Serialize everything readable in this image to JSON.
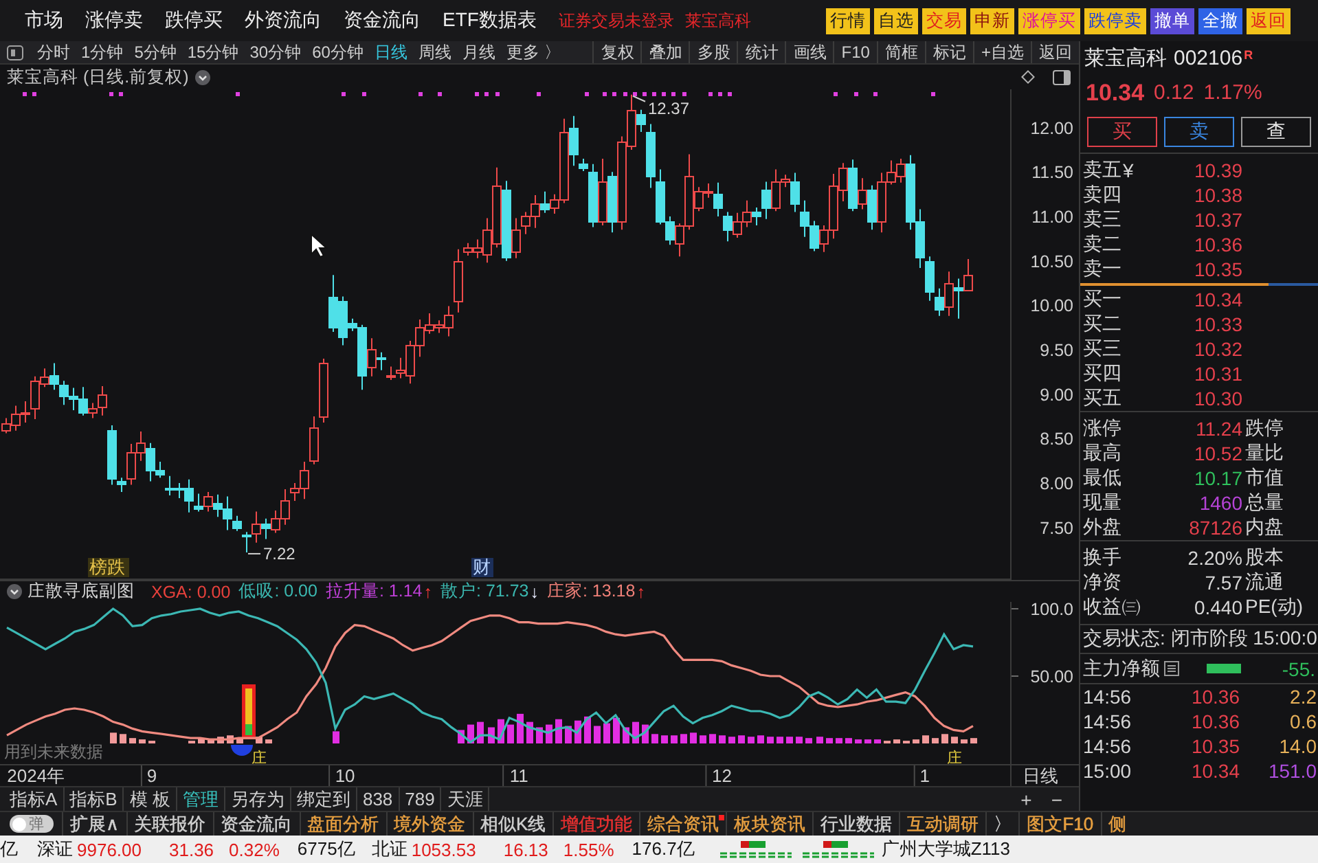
{
  "menu_bar": {
    "items": [
      "市场",
      "涨停卖",
      "跌停买",
      "外资流向",
      "资金流向",
      "ETF数据表"
    ],
    "notices": [
      "证券交易未登录",
      "莱宝高科"
    ],
    "actions": [
      {
        "label": "行情",
        "color": "#f2c21a",
        "kind": "dark"
      },
      {
        "label": "自选",
        "color": "#f2c21a",
        "kind": "dark"
      },
      {
        "label": "交易",
        "color": "#f2c21a",
        "kind": "red"
      },
      {
        "label": "申新",
        "color": "#f2c21a",
        "kind": "maroon"
      },
      {
        "label": "涨停买",
        "color": "#f2c21a",
        "kind": "magenta"
      },
      {
        "label": "跌停卖",
        "color": "#f2c21a",
        "kind": "blue"
      },
      {
        "label": "撤单",
        "color": "#5b4bd6",
        "kind": "white"
      },
      {
        "label": "全撤",
        "color": "#2f63e6",
        "kind": "white"
      },
      {
        "label": "返回",
        "color": "#f2c21a",
        "kind": "red"
      }
    ]
  },
  "toolbar": {
    "periods": [
      {
        "label": "分时",
        "selected": false
      },
      {
        "label": "1分钟",
        "selected": false
      },
      {
        "label": "5分钟",
        "selected": false
      },
      {
        "label": "15分钟",
        "selected": false
      },
      {
        "label": "30分钟",
        "selected": false
      },
      {
        "label": "60分钟",
        "selected": false
      },
      {
        "label": "日线",
        "selected": true
      },
      {
        "label": "周线",
        "selected": false
      },
      {
        "label": "月线",
        "selected": false
      },
      {
        "label": "更多 〉",
        "selected": false
      }
    ],
    "tools": [
      "复权",
      "叠加",
      "多股",
      "统计",
      "画线",
      "F10",
      "简框",
      "标记",
      "+自选",
      "返回"
    ]
  },
  "price_chart": {
    "title": "莱宝高科 (日线.前复权)",
    "markers": [
      {
        "label": "榜跌",
        "kind": "ranking"
      },
      {
        "label": "财",
        "kind": "finance"
      }
    ],
    "chart_data": {
      "type": "candlestick",
      "categories": [
        null,
        null,
        null,
        null,
        null,
        null,
        null,
        null,
        null,
        null,
        null,
        null,
        null,
        null,
        null,
        null,
        null,
        null,
        null,
        null,
        null,
        null,
        null,
        null,
        null,
        null,
        null,
        null,
        null,
        null,
        null,
        null,
        null,
        null,
        null,
        null,
        null,
        null,
        null,
        null,
        null,
        null,
        null,
        null,
        null,
        null,
        null,
        null,
        null,
        null,
        null,
        null,
        null,
        null,
        null,
        null,
        null,
        null,
        null,
        null,
        null,
        null,
        null,
        null,
        null,
        null,
        null,
        null,
        null,
        null,
        null,
        null,
        null,
        null,
        null,
        null,
        null,
        null,
        null,
        null,
        null,
        null,
        null,
        null,
        null,
        null,
        null,
        null,
        null,
        null,
        null,
        null,
        null,
        null,
        null,
        null,
        null,
        null,
        null,
        null,
        null,
        null,
        null,
        null,
        null
      ],
      "ohlc": [
        [
          8.6,
          8.73,
          8.56,
          8.68
        ],
        [
          8.66,
          8.87,
          8.59,
          8.78
        ],
        [
          8.78,
          8.92,
          8.68,
          8.79
        ],
        [
          8.85,
          9.2,
          8.72,
          9.15
        ],
        [
          9.12,
          9.29,
          9.08,
          9.2
        ],
        [
          9.22,
          9.35,
          9.05,
          9.12
        ],
        [
          9.1,
          9.15,
          8.88,
          8.98
        ],
        [
          8.98,
          9.07,
          8.82,
          8.95
        ],
        [
          8.95,
          9.08,
          8.76,
          8.8
        ],
        [
          8.8,
          8.9,
          8.73,
          8.85
        ],
        [
          8.86,
          9.09,
          8.76,
          9.0
        ],
        [
          8.6,
          8.65,
          7.98,
          8.05
        ],
        [
          8.02,
          8.06,
          7.9,
          8.0
        ],
        [
          8.05,
          8.44,
          7.98,
          8.35
        ],
        [
          8.35,
          8.58,
          8.25,
          8.45
        ],
        [
          8.4,
          8.45,
          8.02,
          8.15
        ],
        [
          8.15,
          8.24,
          8.06,
          8.1
        ],
        [
          7.95,
          8.08,
          7.86,
          7.93
        ],
        [
          7.95,
          8.0,
          7.83,
          7.93
        ],
        [
          7.95,
          8.04,
          7.67,
          7.8
        ],
        [
          7.75,
          7.88,
          7.68,
          7.72
        ],
        [
          7.75,
          7.9,
          7.68,
          7.85
        ],
        [
          7.78,
          7.87,
          7.62,
          7.72
        ],
        [
          7.72,
          7.85,
          7.47,
          7.6
        ],
        [
          7.58,
          7.63,
          7.46,
          7.5
        ],
        [
          7.42,
          7.45,
          7.22,
          7.4
        ],
        [
          7.43,
          7.68,
          7.33,
          7.55
        ],
        [
          7.55,
          7.6,
          7.37,
          7.5
        ],
        [
          7.48,
          7.69,
          7.44,
          7.6
        ],
        [
          7.6,
          7.93,
          7.53,
          7.8
        ],
        [
          7.9,
          8.0,
          7.8,
          7.95
        ],
        [
          7.95,
          8.24,
          7.82,
          8.15
        ],
        [
          8.25,
          8.75,
          8.21,
          8.62
        ],
        [
          8.75,
          9.4,
          8.68,
          9.35
        ],
        [
          10.1,
          10.34,
          9.7,
          9.75
        ],
        [
          10.05,
          10.1,
          9.55,
          9.65
        ],
        [
          9.8,
          9.85,
          9.71,
          9.75
        ],
        [
          9.75,
          9.78,
          9.05,
          9.22
        ],
        [
          9.3,
          9.63,
          9.2,
          9.5
        ],
        [
          9.42,
          9.47,
          9.27,
          9.4
        ],
        [
          9.2,
          9.31,
          9.16,
          9.22
        ],
        [
          9.25,
          9.41,
          9.18,
          9.28
        ],
        [
          9.22,
          9.6,
          9.12,
          9.55
        ],
        [
          9.55,
          9.84,
          9.42,
          9.75
        ],
        [
          9.72,
          9.91,
          9.68,
          9.78
        ],
        [
          9.76,
          9.83,
          9.69,
          9.78
        ],
        [
          9.75,
          9.99,
          9.65,
          9.9
        ],
        [
          10.05,
          10.63,
          9.92,
          10.5
        ],
        [
          10.6,
          10.7,
          10.56,
          10.65
        ],
        [
          10.6,
          10.74,
          10.53,
          10.65
        ],
        [
          10.58,
          10.98,
          10.48,
          10.85
        ],
        [
          10.7,
          11.55,
          10.65,
          11.35
        ],
        [
          11.3,
          11.4,
          10.5,
          10.55
        ],
        [
          10.6,
          10.98,
          10.53,
          10.85
        ],
        [
          10.9,
          11.05,
          10.8,
          11.0
        ],
        [
          11.0,
          11.24,
          10.87,
          11.15
        ],
        [
          11.15,
          11.28,
          11.04,
          11.08
        ],
        [
          11.1,
          11.25,
          11.03,
          11.2
        ],
        [
          11.2,
          12.1,
          11.15,
          11.95
        ],
        [
          12.0,
          12.13,
          11.57,
          11.7
        ],
        [
          11.6,
          11.65,
          11.51,
          11.55
        ],
        [
          11.5,
          11.59,
          10.88,
          10.95
        ],
        [
          10.95,
          11.65,
          10.9,
          11.4
        ],
        [
          11.45,
          11.5,
          10.82,
          10.95
        ],
        [
          10.95,
          11.9,
          10.85,
          11.85
        ],
        [
          11.8,
          12.37,
          11.75,
          12.2
        ],
        [
          12.15,
          12.2,
          11.95,
          12.05
        ],
        [
          11.95,
          12.04,
          11.32,
          11.45
        ],
        [
          11.4,
          11.53,
          10.91,
          10.95
        ],
        [
          10.95,
          11.0,
          10.68,
          10.75
        ],
        [
          10.7,
          10.92,
          10.55,
          10.9
        ],
        [
          10.9,
          11.7,
          10.85,
          11.45
        ],
        [
          11.1,
          11.33,
          11.06,
          11.28
        ],
        [
          11.28,
          11.37,
          11.21,
          11.28
        ],
        [
          11.25,
          11.38,
          11.0,
          11.1
        ],
        [
          11.0,
          11.05,
          10.72,
          10.85
        ],
        [
          10.8,
          11.04,
          10.76,
          10.95
        ],
        [
          10.95,
          11.18,
          10.88,
          11.05
        ],
        [
          11.05,
          11.1,
          10.9,
          11.0
        ],
        [
          11.3,
          11.39,
          10.97,
          11.1
        ],
        [
          11.1,
          11.53,
          11.06,
          11.4
        ],
        [
          11.4,
          11.47,
          11.33,
          11.42
        ],
        [
          11.4,
          11.49,
          11.05,
          11.15
        ],
        [
          11.05,
          11.18,
          10.77,
          10.9
        ],
        [
          10.9,
          10.95,
          10.61,
          10.65
        ],
        [
          10.7,
          10.9,
          10.6,
          10.85
        ],
        [
          10.85,
          11.48,
          10.75,
          11.35
        ],
        [
          11.3,
          11.6,
          11.17,
          11.55
        ],
        [
          11.55,
          11.64,
          11.06,
          11.1
        ],
        [
          11.15,
          11.43,
          11.08,
          11.3
        ],
        [
          11.3,
          11.35,
          10.85,
          10.95
        ],
        [
          10.95,
          11.49,
          10.82,
          11.4
        ],
        [
          11.4,
          11.63,
          11.36,
          11.5
        ],
        [
          11.45,
          11.65,
          11.38,
          11.6
        ],
        [
          11.6,
          11.69,
          10.85,
          10.95
        ],
        [
          10.95,
          11.08,
          10.42,
          10.55
        ],
        [
          10.5,
          10.55,
          10.05,
          10.15
        ],
        [
          10.1,
          10.19,
          9.88,
          9.95
        ],
        [
          9.98,
          10.38,
          9.88,
          10.25
        ],
        [
          10.2,
          10.3,
          9.85,
          10.17
        ],
        [
          10.18,
          10.52,
          10.17,
          10.34
        ],
        null,
        null,
        null,
        null
      ],
      "ylim": [
        6.91,
        12.43
      ],
      "yticks": [
        {
          "value": 12,
          "label": "12.00"
        },
        {
          "value": 11.5,
          "label": "11.50"
        },
        {
          "value": 11,
          "label": "11.00"
        },
        {
          "value": 10.5,
          "label": "10.50"
        },
        {
          "value": 10,
          "label": "10.00"
        },
        {
          "value": 9.5,
          "label": "9.50"
        },
        {
          "value": 9,
          "label": "9.00"
        },
        {
          "value": 8.5,
          "label": "8.50"
        },
        {
          "value": 8,
          "label": "8.00"
        },
        {
          "value": 7.5,
          "label": "7.50"
        }
      ],
      "annotations": [
        "12.37",
        "7.22"
      ]
    }
  },
  "indicator": {
    "name": "庄散寻底副图",
    "readings": [
      {
        "text": "XGA: 0.00",
        "color": "#e8413c"
      },
      {
        "text": "低吸: 0.00",
        "color": "#3bb8b0"
      },
      {
        "text": "拉升量: 1.14",
        "color": "#c040d8",
        "arrow": {
          "text": "↑",
          "color": "#ff3a3a"
        }
      },
      {
        "text": "散户: 71.73",
        "color": "#3bb8b0",
        "arrow": {
          "text": "↓",
          "color": "#e8ecff"
        }
      },
      {
        "text": "庄家: 13.18",
        "color": "#f08078",
        "arrow": {
          "text": "↑",
          "color": "#ff3a3a"
        }
      }
    ],
    "note": "用到未来数据",
    "signals": [
      "庄",
      "庄"
    ],
    "period": "日线",
    "chart_data": {
      "type": "line",
      "categories": [
        null,
        null,
        null,
        "2024年",
        null,
        null,
        null,
        null,
        null,
        null,
        null,
        null,
        null,
        null,
        null,
        "9",
        null,
        null,
        null,
        null,
        null,
        null,
        null,
        null,
        null,
        null,
        null,
        null,
        null,
        null,
        null,
        null,
        null,
        null,
        null,
        "10",
        null,
        null,
        null,
        null,
        null,
        null,
        null,
        null,
        null,
        null,
        null,
        null,
        null,
        null,
        null,
        null,
        null,
        "11",
        null,
        null,
        null,
        null,
        null,
        null,
        null,
        null,
        null,
        null,
        null,
        null,
        null,
        null,
        null,
        null,
        null,
        null,
        null,
        null,
        "12",
        null,
        null,
        null,
        null,
        null,
        null,
        null,
        null,
        null,
        null,
        null,
        null,
        null,
        null,
        null,
        null,
        null,
        null,
        null,
        null,
        "1",
        null,
        null,
        null,
        null,
        null
      ],
      "series": [
        {
          "type": "bar",
          "color": "#f29a9a",
          "values": [
            null,
            null,
            null,
            null,
            null,
            null,
            null,
            null,
            null,
            null,
            null,
            8,
            7,
            4,
            3,
            2,
            null,
            null,
            null,
            2,
            4,
            3,
            5,
            6,
            4,
            null,
            5,
            3,
            null,
            null,
            null,
            null,
            null,
            null,
            null,
            null,
            null,
            null,
            null,
            null,
            null,
            null,
            null,
            null,
            null,
            null,
            null,
            null,
            null,
            null,
            null,
            null,
            null,
            null,
            null,
            null,
            null,
            null,
            null,
            null,
            null,
            null,
            null,
            null,
            null,
            null,
            null,
            null,
            null,
            null,
            null,
            null,
            null,
            null,
            null,
            null,
            null,
            null,
            null,
            null,
            null,
            null,
            null,
            null,
            null,
            null,
            null,
            null,
            null,
            null,
            null,
            2,
            3,
            2,
            3,
            6,
            4,
            7,
            5,
            3,
            4
          ]
        },
        {
          "type": "bar",
          "color": "#e22ee2",
          "values": [
            null,
            null,
            null,
            null,
            null,
            null,
            null,
            null,
            null,
            null,
            null,
            null,
            null,
            null,
            null,
            null,
            null,
            null,
            null,
            null,
            null,
            null,
            null,
            null,
            null,
            null,
            null,
            null,
            null,
            null,
            null,
            null,
            null,
            null,
            9,
            null,
            null,
            null,
            null,
            null,
            null,
            null,
            null,
            null,
            null,
            null,
            null,
            10,
            14,
            16,
            12,
            18,
            14,
            22,
            16,
            12,
            14,
            18,
            13,
            17,
            20,
            13,
            15,
            19,
            12,
            16,
            14,
            7,
            6,
            6,
            7,
            8,
            6,
            7,
            6,
            5,
            6,
            5,
            6,
            5,
            5,
            5,
            5,
            4,
            5,
            4,
            4,
            4,
            3,
            3,
            3,
            null,
            null,
            null,
            null,
            null,
            null,
            null,
            null,
            null,
            null
          ]
        },
        {
          "color": "#f08a80",
          "values": [
            6,
            10,
            14,
            17,
            20,
            22,
            25,
            26,
            25,
            23,
            20,
            16,
            14,
            11,
            9,
            8,
            7,
            6,
            5,
            4,
            4,
            3,
            3,
            3,
            4,
            4,
            4,
            8,
            12,
            18,
            23,
            35,
            44,
            56,
            72,
            82,
            88,
            87,
            84,
            81,
            78,
            73,
            69,
            71,
            73,
            76,
            81,
            86,
            91,
            93,
            95,
            95,
            93,
            90,
            90,
            89,
            89,
            89,
            90,
            89,
            88,
            86,
            83,
            81,
            80,
            81,
            82,
            83,
            80,
            70,
            62,
            62,
            62,
            62,
            61,
            58,
            56,
            54,
            51,
            50,
            50,
            46,
            42,
            36,
            30,
            28,
            27,
            28,
            29,
            31,
            32,
            34,
            36,
            38,
            35,
            28,
            19,
            13,
            10,
            9,
            13
          ]
        },
        {
          "color": "#3cb8b4",
          "values": [
            86,
            82,
            78,
            74,
            70,
            74,
            78,
            83,
            85,
            88,
            94,
            100,
            95,
            87,
            88,
            93,
            95,
            96,
            98,
            99,
            100,
            97,
            95,
            97,
            98,
            95,
            93,
            90,
            87,
            82,
            77,
            70,
            60,
            45,
            11,
            25,
            29,
            35,
            33,
            35,
            37,
            33,
            29,
            23,
            20,
            18,
            12,
            7,
            1,
            6,
            6,
            3,
            19,
            16,
            12,
            10,
            8,
            11,
            12,
            8,
            18,
            23,
            15,
            21,
            10,
            4,
            8,
            16,
            24,
            28,
            20,
            15,
            19,
            21,
            24,
            28,
            26,
            24,
            24,
            22,
            19,
            21,
            27,
            35,
            38,
            34,
            29,
            33,
            40,
            34,
            40,
            31,
            31,
            30,
            40,
            54,
            67,
            81,
            70,
            73,
            72
          ]
        }
      ],
      "ylim": [
        -15.3,
        105.1
      ],
      "yticks": [
        {
          "value": 100,
          "label": "100.0"
        },
        {
          "value": 50,
          "label": "50.00"
        }
      ]
    }
  },
  "indicator_tabs": {
    "items": [
      {
        "label": "指标A",
        "selected": false
      },
      {
        "label": "指标B",
        "selected": false
      },
      {
        "label": "模 板",
        "selected": false
      },
      {
        "label": "管理",
        "selected": true
      },
      {
        "label": "另存为",
        "selected": false
      },
      {
        "label": "绑定到",
        "selected": false
      },
      {
        "label": "838",
        "selected": false
      },
      {
        "label": "789",
        "selected": false
      },
      {
        "label": "天涯",
        "selected": false
      }
    ],
    "zoom": [
      "+",
      "−"
    ]
  },
  "quote_panel": {
    "name": "莱宝高科",
    "code": "002106",
    "badge": "R",
    "price": "10.34",
    "change": "0.12",
    "change_pct": "1.17%",
    "color": "#e5404c",
    "buttons": [
      {
        "label": "买",
        "kind": "buy"
      },
      {
        "label": "卖",
        "kind": "sell"
      },
      {
        "label": "查",
        "kind": "query"
      }
    ],
    "asks": [
      {
        "label": "卖五",
        "tag": "¥",
        "price": "10.39",
        "color": "#e5404c"
      },
      {
        "label": "卖四",
        "price": "10.38",
        "color": "#e5404c"
      },
      {
        "label": "卖三",
        "price": "10.37",
        "color": "#e5404c"
      },
      {
        "label": "卖二",
        "price": "10.36",
        "color": "#e5404c"
      },
      {
        "label": "卖一",
        "price": "10.35",
        "color": "#e5404c"
      }
    ],
    "book_ratio": {
      "level": 0.79
    },
    "bids": [
      {
        "label": "买一",
        "price": "10.34",
        "color": "#e5404c"
      },
      {
        "label": "买二",
        "price": "10.33",
        "color": "#e5404c"
      },
      {
        "label": "买三",
        "price": "10.32",
        "color": "#e5404c"
      },
      {
        "label": "买四",
        "price": "10.31",
        "color": "#e5404c"
      },
      {
        "label": "买五",
        "price": "10.30",
        "color": "#e5404c"
      }
    ],
    "stats": [
      {
        "label": "涨停",
        "value": "11.24",
        "color": "#e5404c",
        "pair": "跌停"
      },
      {
        "label": "最高",
        "value": "10.52",
        "color": "#e5404c",
        "pair": "量比"
      },
      {
        "label": "最低",
        "value": "10.17",
        "color": "#2fbf5c",
        "pair": "市值"
      },
      {
        "label": "现量",
        "value": "1460",
        "color": "#b543d6",
        "pair": "总量"
      },
      {
        "label": "外盘",
        "value": "87126",
        "color": "#e5404c",
        "pair": "内盘"
      }
    ],
    "finance": [
      {
        "label": "换手",
        "value": "2.20%",
        "color": "#d6d6d6",
        "pair": "股本"
      },
      {
        "label": "净资",
        "value": "7.57",
        "color": "#d6d6d6",
        "pair": "流通"
      },
      {
        "label": "收益㈢",
        "value": "0.440",
        "color": "#d6d6d6",
        "pair": "PE(动)"
      }
    ],
    "trade_status": "交易状态: 闭市阶段 15:00:0",
    "main_flow": {
      "label": "主力净额",
      "value": "-55.",
      "color": "#2fbf5c"
    },
    "ticks": [
      {
        "time": "14:56",
        "price": "10.36",
        "color": "#e5404c",
        "volume": {
          "text": "2.2",
          "color": "#e8b25a"
        }
      },
      {
        "time": "14:56",
        "price": "10.36",
        "color": "#e5404c",
        "volume": {
          "text": "0.6",
          "color": "#e8b25a"
        }
      },
      {
        "time": "14:56",
        "price": "10.35",
        "color": "#e5404c",
        "volume": {
          "text": "14.0",
          "color": "#e8b25a"
        }
      },
      {
        "time": "15:00",
        "price": "10.34",
        "color": "#e5404c",
        "volume": {
          "text": "151.0",
          "color": "#b04fe0"
        }
      }
    ]
  },
  "function_bar": {
    "toggle": {
      "label": "弹",
      "on": false
    },
    "items": [
      {
        "label": "扩展∧",
        "color": "#d0d0d0",
        "badge": false
      },
      {
        "label": "关联报价",
        "color": "#d0d0d0",
        "badge": false
      },
      {
        "label": "资金流向",
        "color": "#d0d0d0",
        "badge": false
      },
      {
        "label": "盘面分析",
        "color": "#e8a040",
        "badge": false
      },
      {
        "label": "境外资金",
        "color": "#e8a040",
        "badge": false
      },
      {
        "label": "相似K线",
        "color": "#d0d0d0",
        "badge": false
      },
      {
        "label": "增值功能",
        "color": "#e83030",
        "badge": false
      },
      {
        "label": "综合资讯",
        "color": "#e8a040",
        "badge": true
      },
      {
        "label": "板块资讯",
        "color": "#e8a040",
        "badge": false
      },
      {
        "label": "行业数据",
        "color": "#d0d0d0",
        "badge": false
      },
      {
        "label": "互动调研",
        "color": "#e8a040",
        "badge": false
      },
      {
        "label": "〉",
        "color": "#d0d0d0",
        "badge": false
      },
      {
        "label": "图文F10",
        "color": "#e8a040",
        "badge": false
      },
      {
        "label": "侧",
        "color": "#e8a040",
        "badge": false
      }
    ]
  },
  "status_bar": {
    "lead": "亿",
    "indices": [
      {
        "name": "深证",
        "value": "9976.00",
        "change": "31.36",
        "percent": "0.32%",
        "turnover": "6775亿",
        "color": "#e01c1c"
      },
      {
        "name": "北证",
        "value": "1053.53",
        "change": "16.13",
        "percent": "1.55%",
        "turnover": "176.7亿",
        "color": "#e01c1c"
      }
    ],
    "location": "广州大学城Z113"
  }
}
